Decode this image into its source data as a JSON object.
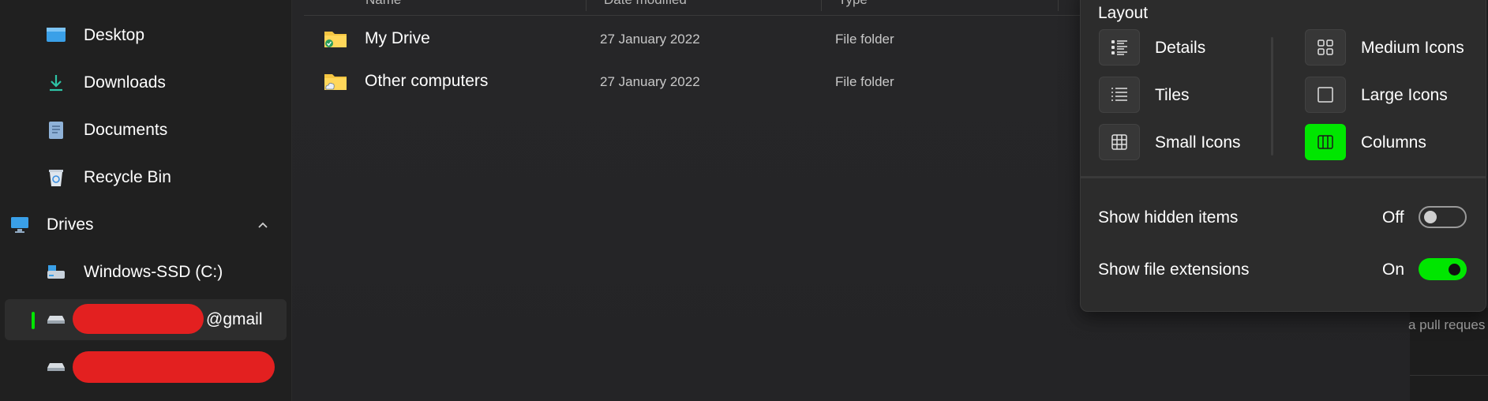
{
  "sidebar": {
    "items": [
      {
        "label": "Desktop",
        "icon": "desktop-icon"
      },
      {
        "label": "Downloads",
        "icon": "download-icon"
      },
      {
        "label": "Documents",
        "icon": "document-icon"
      },
      {
        "label": "Recycle Bin",
        "icon": "recycle-bin-icon"
      }
    ],
    "drives": {
      "label": "Drives",
      "icon": "monitor-icon",
      "expanded_icon": "chevron-up-icon"
    },
    "drive_items": [
      {
        "label": "Windows-SSD (C:)",
        "icon": "ssd-drive-icon"
      },
      {
        "label": "@gmail",
        "icon": "network-drive-icon",
        "selected": true
      },
      {
        "label": "",
        "icon": "network-drive-icon"
      }
    ]
  },
  "columns": {
    "name": "Name",
    "date": "Date modified",
    "type": "Type"
  },
  "files": [
    {
      "name": "My Drive",
      "date": "27 January 2022",
      "type": "File folder",
      "icon": "folder-sync-icon"
    },
    {
      "name": "Other computers",
      "date": "27 January 2022",
      "type": "File folder",
      "icon": "folder-cloud-icon"
    }
  ],
  "background_text": "a pull reques",
  "layout_flyout": {
    "title": "Layout",
    "options": [
      {
        "label": "Details",
        "icon": "details-icon"
      },
      {
        "label": "Tiles",
        "icon": "tiles-icon"
      },
      {
        "label": "Small Icons",
        "icon": "small-icons-icon"
      },
      {
        "label": "Medium Icons",
        "icon": "medium-icons-icon"
      },
      {
        "label": "Large Icons",
        "icon": "large-icons-icon"
      },
      {
        "label": "Columns",
        "icon": "columns-icon",
        "active": true
      }
    ],
    "settings": [
      {
        "label": "Show hidden items",
        "state": "Off"
      },
      {
        "label": "Show file extensions",
        "state": "On"
      }
    ]
  },
  "colors": {
    "accent": "#00e600",
    "redaction": "#e32020",
    "background": "#202020"
  }
}
